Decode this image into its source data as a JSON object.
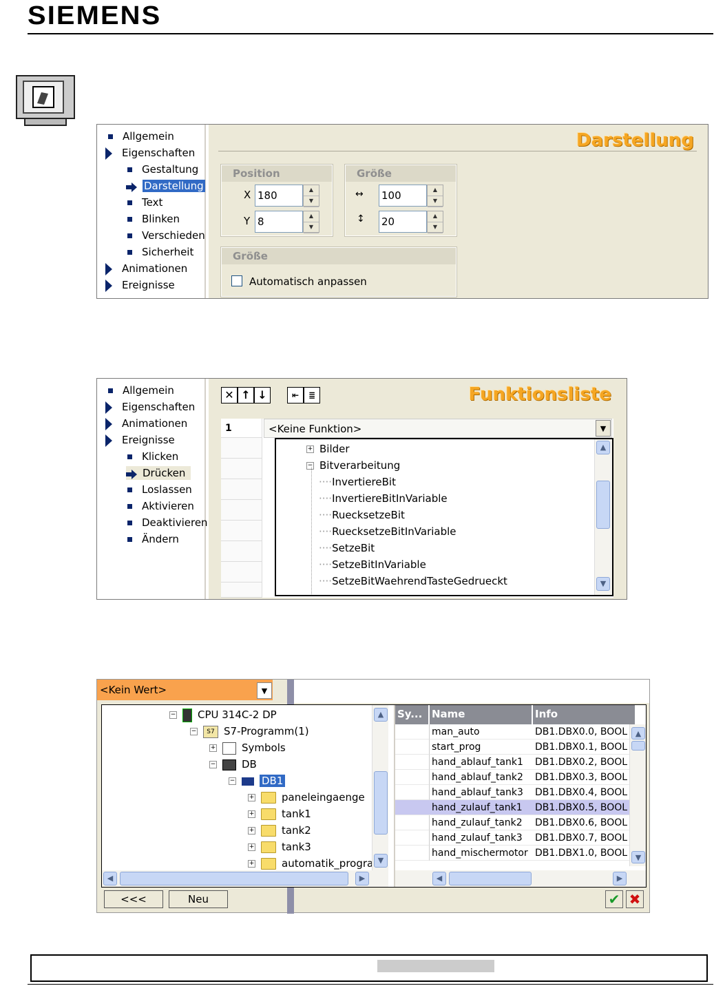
{
  "header": {
    "logo": "SIEMENS"
  },
  "darstellung": {
    "tree": [
      "Allgemein",
      "Eigenschaften",
      "Gestaltung",
      "Darstellung",
      "Text",
      "Blinken",
      "Verschieden",
      "Sicherheit",
      "Animationen",
      "Ereignisse"
    ],
    "title": "Darstellung",
    "position": {
      "label": "Position",
      "x_label": "X",
      "x": "180",
      "y_label": "Y",
      "y": "8"
    },
    "size": {
      "label": "Größe",
      "w": "100",
      "h": "20"
    },
    "size2": {
      "label": "Größe",
      "auto_label": "Automatisch anpassen"
    }
  },
  "funktion": {
    "tree": [
      "Allgemein",
      "Eigenschaften",
      "Animationen",
      "Ereignisse",
      "Klicken",
      "Drücken",
      "Loslassen",
      "Aktivieren",
      "Deaktivieren",
      "Ändern"
    ],
    "title": "Funktionsliste",
    "row_num": "1",
    "combo": "<Keine Funktion>",
    "items": [
      "Bilder",
      "Bitverarbeitung",
      "InvertiereBit",
      "InvertiereBitInVariable",
      "RuecksetzeBit",
      "RuecksetzeBitInVariable",
      "SetzeBit",
      "SetzeBitInVariable",
      "SetzeBitWaehrendTasteGedrueckt"
    ]
  },
  "variable": {
    "combo": "<Kein Wert>",
    "tree": [
      "CPU 314C-2 DP",
      "S7-Programm(1)",
      "Symbols",
      "DB",
      "DB1",
      "paneleingaenge",
      "tank1",
      "tank2",
      "tank3",
      "automatik_progra"
    ],
    "columns": [
      "Sy...",
      "Name",
      "Info"
    ],
    "rows": [
      [
        "man_auto",
        "DB1.DBX0.0, BOOL"
      ],
      [
        "start_prog",
        "DB1.DBX0.1, BOOL"
      ],
      [
        "hand_ablauf_tank1",
        "DB1.DBX0.2, BOOL"
      ],
      [
        "hand_ablauf_tank2",
        "DB1.DBX0.3, BOOL"
      ],
      [
        "hand_ablauf_tank3",
        "DB1.DBX0.4, BOOL"
      ],
      [
        "hand_zulauf_tank1",
        "DB1.DBX0.5, BOOL"
      ],
      [
        "hand_zulauf_tank2",
        "DB1.DBX0.6, BOOL"
      ],
      [
        "hand_zulauf_tank3",
        "DB1.DBX0.7, BOOL"
      ],
      [
        "hand_mischermotor",
        "DB1.DBX1.0, BOOL"
      ]
    ],
    "back_label": "<<<",
    "new_label": "Neu",
    "ok_icon": "checkmark-icon",
    "cancel_icon": "x-icon"
  },
  "colors": {
    "accent": "#f5a623",
    "selection": "#316ac5",
    "orange_combo": "#f9a24d"
  }
}
